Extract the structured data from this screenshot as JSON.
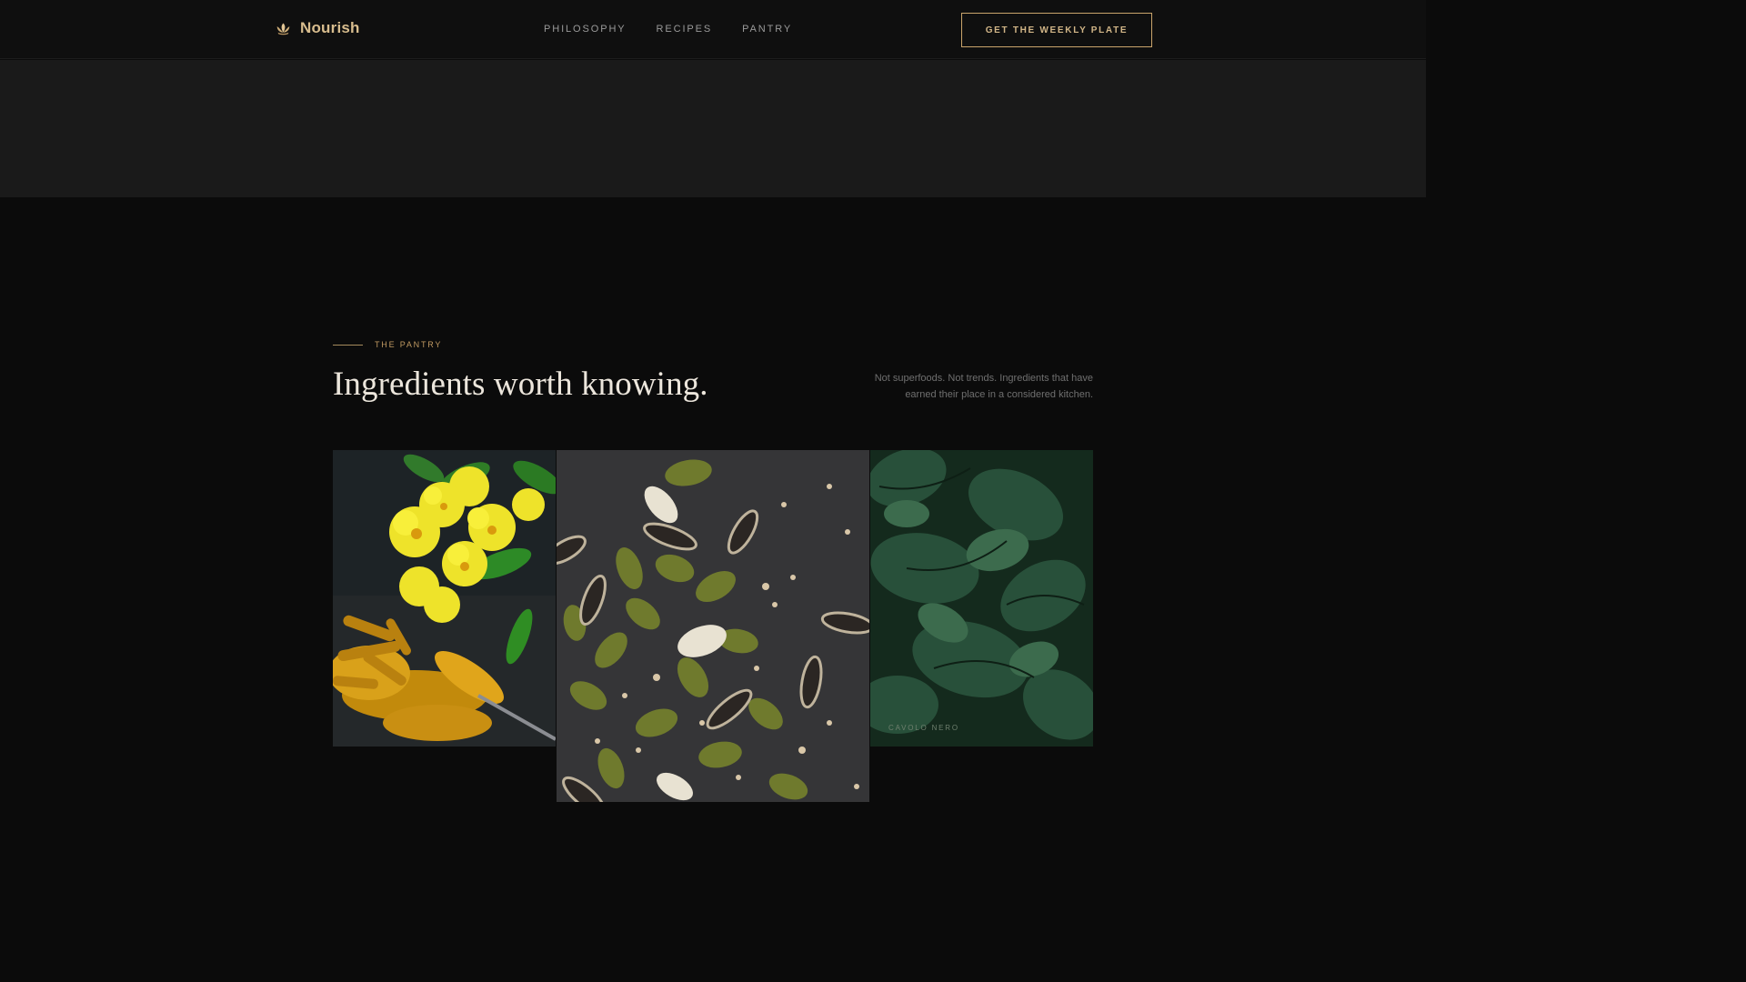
{
  "header": {
    "brand_name": "Nourish",
    "brand_icon": "lotus-icon",
    "nav": [
      {
        "label": "PHILOSOPHY"
      },
      {
        "label": "RECIPES"
      },
      {
        "label": "PANTRY"
      }
    ],
    "cta_label": "GET THE WEEKLY PLATE"
  },
  "pantry": {
    "eyebrow": "THE PANTRY",
    "headline": "Ingredients worth knowing.",
    "intro": "Not superfoods. Not trends. Ingredients that have earned their place in a considered kitchen.",
    "tiles": [
      {
        "caption": ""
      },
      {
        "caption": ""
      },
      {
        "caption": "CAVOLO NERO"
      }
    ]
  },
  "colors": {
    "background": "#0b0b0b",
    "header": "#0f0f0f",
    "band": "#1a1a1a",
    "accent_gold": "#c9a46b",
    "headline": "#ece6dc",
    "muted_text": "#6f6f6f"
  }
}
